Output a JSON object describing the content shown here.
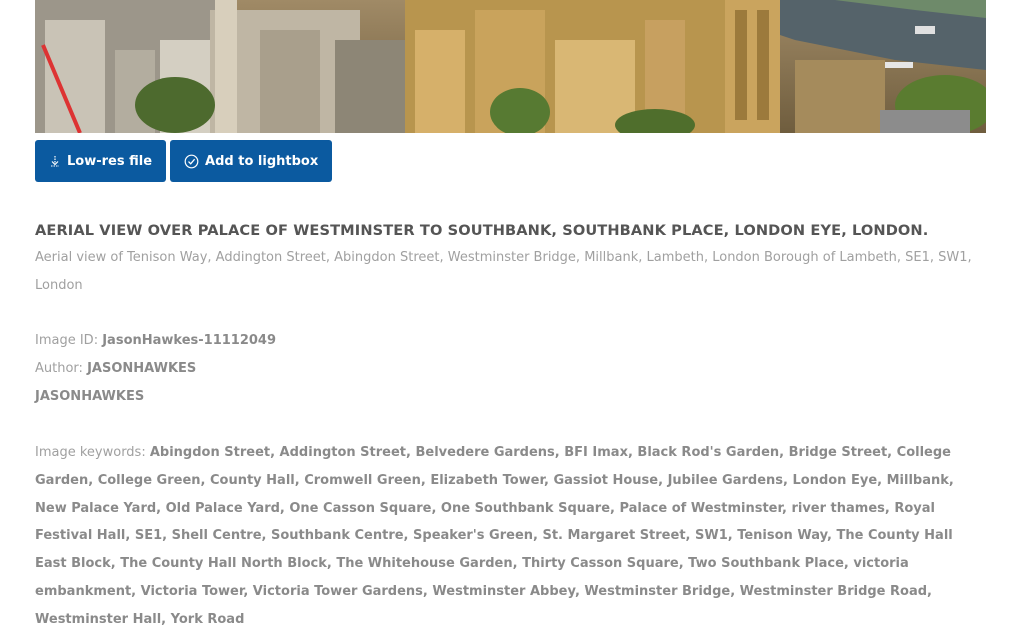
{
  "photo": {
    "alt_icon": "aerial-photo"
  },
  "buttons": {
    "lowres_label": "Low-res file",
    "lightbox_label": "Add to lightbox"
  },
  "image": {
    "title": "AERIAL VIEW OVER PALACE OF WESTMINSTER TO SOUTHBANK, SOUTHBANK PLACE, LONDON EYE, LONDON.",
    "description": "Aerial view of Tenison Way, Addington Street, Abingdon Street, Westminster Bridge, Millbank, Lambeth, London Borough of Lambeth, SE1, SW1, London",
    "id_label": "Image ID:",
    "id_value": "JasonHawkes-11112049",
    "author_label": "Author:",
    "author_value": "JASONHAWKES",
    "credit": "JASONHAWKES",
    "keywords_label": "Image keywords:",
    "keywords": "Abingdon Street, Addington Street, Belvedere Gardens, BFI Imax, Black Rod's Garden, Bridge Street, College Garden, College Green, County Hall, Cromwell Green, Elizabeth Tower, Gassiot House, Jubilee Gardens, London Eye, Millbank, New Palace Yard, Old Palace Yard, One Casson Square, One Southbank Square, Palace of Westminster, river thames, Royal Festival Hall, SE1, Shell Centre, Southbank Centre, Speaker's Green, St. Margaret Street, SW1, Tenison Way, The County Hall East Block, The County Hall North Block, The Whitehouse Garden, Thirty Casson Square, Two Southbank Place, victoria embankment, Victoria Tower, Victoria Tower Gardens, Westminster Abbey, Westminster Bridge, Westminster Bridge Road, Westminster Hall, York Road"
  },
  "colors": {
    "button_bg": "#0b5aa0",
    "title": "#555555",
    "text": "#a0a0a0"
  }
}
